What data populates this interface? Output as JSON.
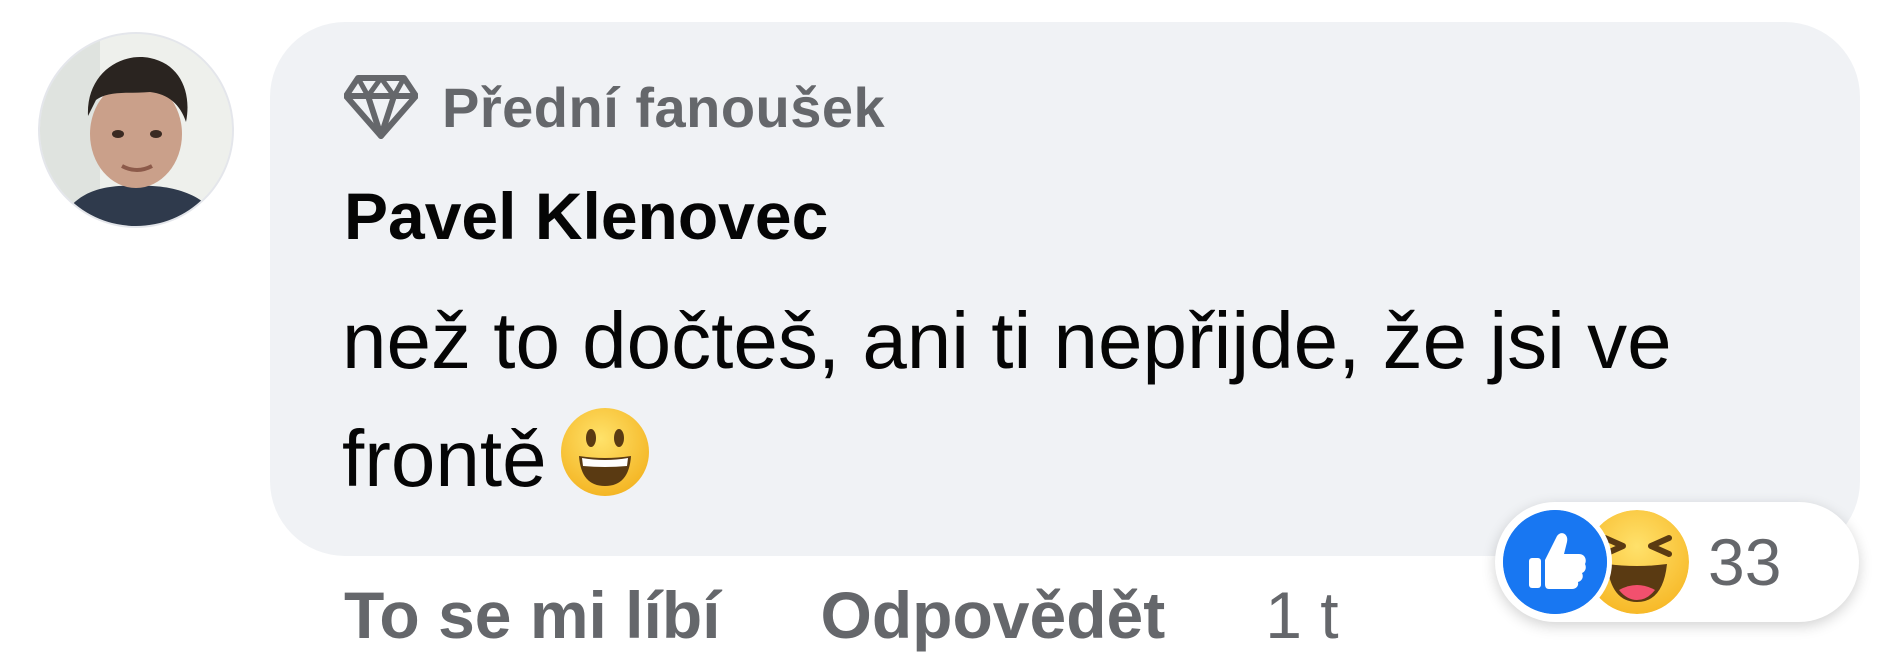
{
  "comment": {
    "badge": {
      "icon": "diamond-icon",
      "label": "Přední fanoušek"
    },
    "author": "Pavel Klenovec",
    "text": "než to dočteš, ani ti nepřijde, že jsi ve frontě",
    "emoji": "smiling-face-emoji",
    "actions": {
      "like_label": "To se mi líbí",
      "reply_label": "Odpovědět",
      "timestamp": "1 t"
    },
    "reactions": {
      "types": [
        "like-reaction-icon",
        "haha-reaction-icon"
      ],
      "count": "33"
    }
  },
  "colors": {
    "bubble_background": "#f0f2f5",
    "secondary_text": "#65676b",
    "primary_text": "#050505",
    "like_blue": "#1877f2",
    "haha_yellow": "#f7b928"
  }
}
